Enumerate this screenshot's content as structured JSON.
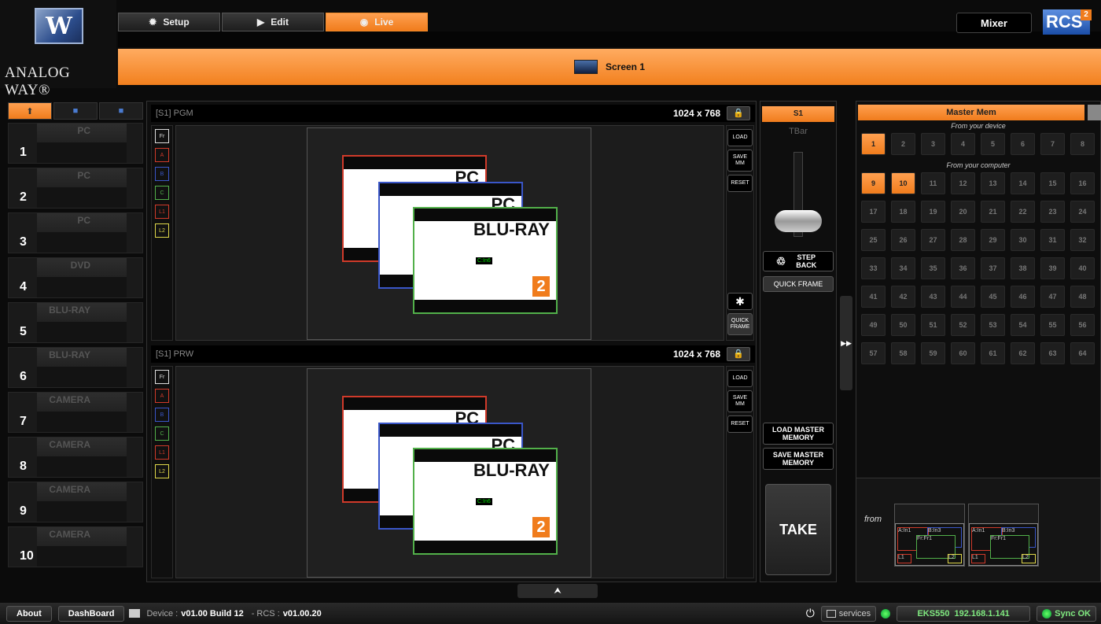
{
  "brand": {
    "logo_text": "ANALOG WAY®",
    "logo_glyph": "W"
  },
  "top_tabs": [
    {
      "label": "Setup",
      "icon": "gear-icon",
      "glyph": "✹"
    },
    {
      "label": "Edit",
      "icon": "play-icon",
      "glyph": "▶"
    },
    {
      "label": "Live",
      "icon": "record-icon",
      "glyph": "◉"
    }
  ],
  "active_tab": "Live",
  "mixer_label": "Mixer",
  "rcs": {
    "text": "RCS",
    "sup": "2"
  },
  "screen_label": "Screen 1",
  "sources": [
    {
      "num": "1",
      "name": "PC"
    },
    {
      "num": "2",
      "name": "PC"
    },
    {
      "num": "3",
      "name": "PC"
    },
    {
      "num": "4",
      "name": "DVD"
    },
    {
      "num": "5",
      "name": "BLU-RAY"
    },
    {
      "num": "6",
      "name": "BLU-RAY"
    },
    {
      "num": "7",
      "name": "CAMERA"
    },
    {
      "num": "8",
      "name": "CAMERA"
    },
    {
      "num": "9",
      "name": "CAMERA"
    },
    {
      "num": "10",
      "name": "CAMERA"
    }
  ],
  "pgm": {
    "title": "[S1] PGM",
    "resolution": "1024 x 768"
  },
  "prw": {
    "title": "[S1] PRW",
    "resolution": "1024 x 768"
  },
  "layers": [
    "Fr",
    "A",
    "B",
    "C",
    "L1",
    "L2"
  ],
  "layer_colors": {
    "Fr": "#dddddd",
    "A": "#d03a2a",
    "B": "#3a56c8",
    "C": "#52b04a",
    "L1": "#d03a2a",
    "L2": "#e0d84a"
  },
  "windows": {
    "a": "PC",
    "b": "PC",
    "c": "BLU-RAY",
    "code": "C:In6",
    "badge": "2"
  },
  "side_buttons": {
    "load": "LOAD",
    "save": "SAVE MM",
    "reset": "RESET",
    "quick_frame": "QUICK FRAME"
  },
  "tbar": {
    "tab": "S1",
    "label": "TBar",
    "step_back": "STEP BACK",
    "quick_frame": "QUICK FRAME",
    "load_mm": "LOAD MASTER MEMORY",
    "save_mm": "SAVE MASTER MEMORY",
    "take": "TAKE"
  },
  "master_mem": {
    "title": "Master Mem",
    "device_label": "From your device",
    "computer_label": "From your computer",
    "device": [
      "1",
      "2",
      "3",
      "4",
      "5",
      "6",
      "7",
      "8"
    ],
    "device_active": [
      "1"
    ],
    "computer": [
      "9",
      "10",
      "11",
      "12",
      "13",
      "14",
      "15",
      "16",
      "17",
      "18",
      "19",
      "20",
      "21",
      "22",
      "23",
      "24",
      "25",
      "26",
      "27",
      "28",
      "29",
      "30",
      "31",
      "32",
      "33",
      "34",
      "35",
      "36",
      "37",
      "38",
      "39",
      "40",
      "41",
      "42",
      "43",
      "44",
      "45",
      "46",
      "47",
      "48",
      "49",
      "50",
      "51",
      "52",
      "53",
      "54",
      "55",
      "56",
      "57",
      "58",
      "59",
      "60",
      "61",
      "62",
      "63",
      "64"
    ],
    "computer_active": [
      "9",
      "10"
    ],
    "from_label": "from",
    "thumb_labels": {
      "a": "A:In1",
      "b": "B:In3",
      "fr": "Fr:Fr1",
      "l1": "L1",
      "l2": "L2"
    }
  },
  "status": {
    "about": "About",
    "dashboard": "DashBoard",
    "device_label": "Device :",
    "device_version": "v01.00 Build 12",
    "rcs_label": "- RCS :",
    "rcs_version": "v01.00.20",
    "services": "services",
    "device_id": "EKS550",
    "ip": "192.168.1.141",
    "sync": "Sync OK"
  }
}
